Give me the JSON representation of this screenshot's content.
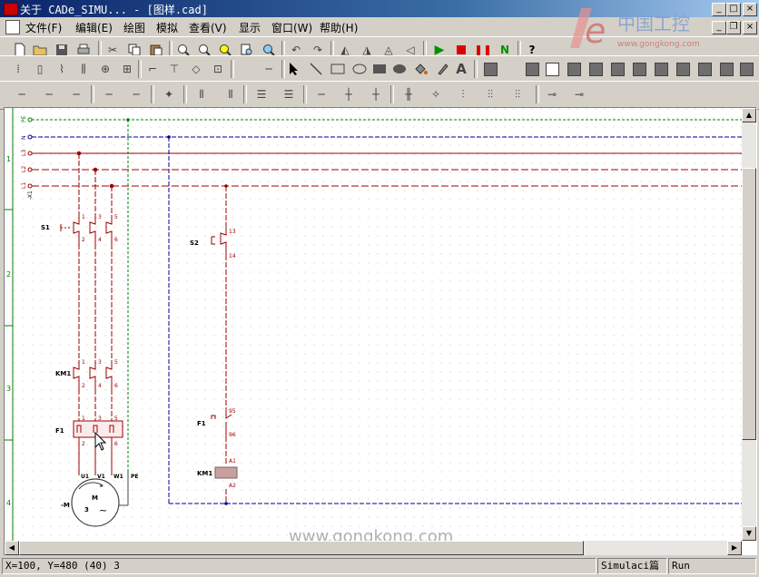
{
  "window": {
    "title": "关于 CADe_SIMU... - [图样.cad]"
  },
  "window_buttons": {
    "minimize": "_",
    "maximize": "□",
    "close": "×"
  },
  "doc_buttons": {
    "minimize": "_",
    "restore": "❐",
    "close": "×"
  },
  "menu": [
    {
      "label": "文件(F)"
    },
    {
      "label": "编辑(E)"
    },
    {
      "label": "绘图"
    },
    {
      "label": "模拟"
    },
    {
      "label": "查看(V)"
    },
    {
      "label": "显示"
    },
    {
      "label": "窗口(W)"
    },
    {
      "label": "帮助(H)"
    }
  ],
  "logo": {
    "text": "中国工控",
    "url": "www.gongkong.com"
  },
  "toolbar_help": "?",
  "draw_text_tool": "A",
  "schematic": {
    "bus_labels": [
      "PE",
      "N",
      "L3",
      "L2",
      "L1"
    ],
    "bus_prefix": "-X1",
    "row_numbers": [
      "1",
      "2",
      "3",
      "4"
    ],
    "s1": {
      "label": "S1",
      "pins_top": [
        "1",
        "3",
        "5"
      ],
      "pins_bottom": [
        "2",
        "4",
        "6"
      ]
    },
    "km1_main": {
      "label": "KM1",
      "pins_top": [
        "1",
        "3",
        "5"
      ],
      "pins_bottom": [
        "2",
        "4",
        "6"
      ]
    },
    "f1_main": {
      "label": "F1",
      "pins_top": [
        "1",
        "3",
        "5"
      ],
      "pins_bottom": [
        "2",
        "4",
        "6"
      ]
    },
    "motor": {
      "terminals": [
        "U1",
        "V1",
        "W1",
        "PE"
      ],
      "label": "-M",
      "center_text": "M",
      "phase": "3",
      "wave": "~"
    },
    "s2": {
      "label": "S2",
      "pins": [
        "13",
        "14"
      ]
    },
    "f1_aux": {
      "label": "F1",
      "pins": [
        "95",
        "96"
      ]
    },
    "km1_coil": {
      "label": "KM1",
      "pins": [
        "A1",
        "A2"
      ]
    }
  },
  "watermark": "www.gongkong.com",
  "status": {
    "coords": "X=100, Y=480 (40) 3",
    "mode": "Simulaci篇",
    "state": "Run"
  },
  "colors": {
    "phase": "#a00000",
    "neutral": "#00008b",
    "earth": "#008000",
    "titlebar": "#0a246a"
  }
}
